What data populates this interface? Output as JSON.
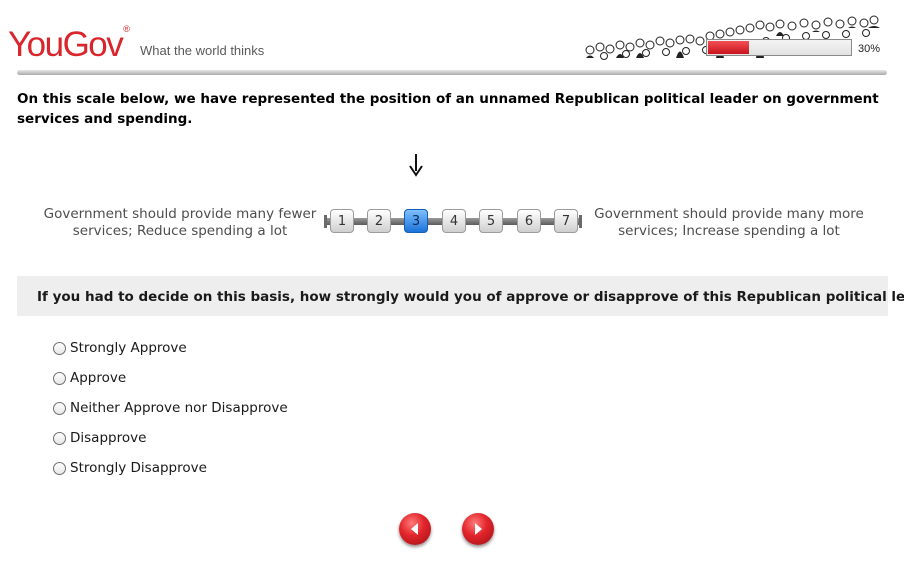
{
  "header": {
    "logo_text": "YouGov",
    "logo_reg": "®",
    "tagline": "What the world thinks",
    "progress_percent": 30,
    "progress_label": "30%"
  },
  "intro": {
    "text": "On this scale below, we have represented the position of an unnamed Republican political leader on government services and spending."
  },
  "scale": {
    "left_label": "Government should provide many fewer services; Reduce spending a lot",
    "right_label": "Government should provide many more services; Increase spending a lot",
    "points": [
      "1",
      "2",
      "3",
      "4",
      "5",
      "6",
      "7"
    ],
    "selected": "3"
  },
  "question": {
    "text": "If you had to decide on this basis, how strongly would you of approve or disapprove of this Republican political leader?"
  },
  "options": [
    {
      "label": "Strongly Approve"
    },
    {
      "label": "Approve"
    },
    {
      "label": "Neither Approve nor Disapprove"
    },
    {
      "label": "Disapprove"
    },
    {
      "label": "Strongly Disapprove"
    }
  ],
  "colors": {
    "brand_red": "#d9252b",
    "selected_blue": "#1a73d9",
    "question_band": "#eeeeee"
  }
}
